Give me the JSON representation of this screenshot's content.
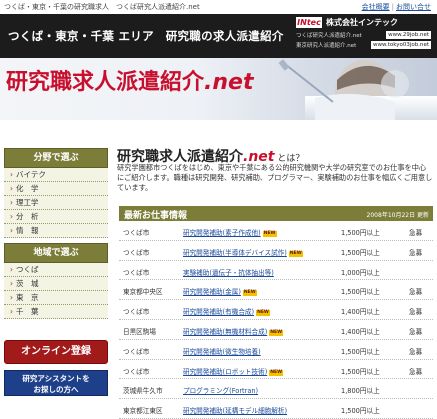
{
  "top": {
    "tagline": "つくば・東京・千葉の研究職求人　つくば研究人派遣紹介.net",
    "links": [
      "会社概要",
      "お問い合せ"
    ]
  },
  "header": {
    "title": "つくば・東京・千葉 エリア　研究職の求人派遣紹介",
    "company_logo": "INtec",
    "company_name": "株式会社インテック",
    "sites": [
      {
        "label": "つくば研究人派遣紹介.net",
        "url": "www.29job.net"
      },
      {
        "label": "東京研究人派遣紹介.net",
        "url": "www.tokyo03job.net"
      }
    ]
  },
  "hero": {
    "title_main": "研究職求人派遣紹介",
    "title_net": ".net"
  },
  "sidebar": {
    "field_heading": "分野で選ぶ",
    "field_items": [
      "バイテク",
      "化　学",
      "理工学",
      "分　析",
      "情　報"
    ],
    "region_heading": "地域で選ぶ",
    "region_items": [
      "つくば",
      "茨　城",
      "東　京",
      "千　葉"
    ],
    "register_label": "オンライン登録",
    "assistant_line1": "研究アシスタントを",
    "assistant_line2": "お探しの方へ"
  },
  "intro": {
    "title_main": "研究職求人派遣紹介",
    "title_net": ".net",
    "title_suffix": " とは？",
    "body": "研究学園都市つくばをはじめ、東京や千葉にある公的研究機関や大学の研究室でのお仕事を中心にご紹介します。職種は研究開発、研究補助、プログラマー、実験補助のお仕事を幅広くご用意しています。"
  },
  "jobs": {
    "heading": "最新お仕事情報",
    "updated": "2008年10月22日 更新",
    "badge": "NEW",
    "rows": [
      {
        "location": "つくば市",
        "title": "研究開発補助(素子作成他)",
        "new": true,
        "salary": "1,500円以上",
        "status": "急募"
      },
      {
        "location": "つくば市",
        "title": "研究開発補助(半導体デバイス試作)",
        "new": true,
        "salary": "1,500円以上",
        "status": "急募"
      },
      {
        "location": "つくば市",
        "title": "実験補助(遺伝子・抗体抽出等)",
        "new": false,
        "salary": "1,000円以上",
        "status": ""
      },
      {
        "location": "東京都中央区",
        "title": "研究開発補助(金属)",
        "new": true,
        "salary": "1,500円以上",
        "status": "急募"
      },
      {
        "location": "つくば市",
        "title": "研究開発補助(有機合成)",
        "new": true,
        "salary": "1,400円以上",
        "status": "急募"
      },
      {
        "location": "日黒区駒場",
        "title": "研究開発補助(無機材料合成)",
        "new": true,
        "salary": "1,400円以上",
        "status": "急募"
      },
      {
        "location": "つくば市",
        "title": "研究開発補助(微生物培養)",
        "new": false,
        "salary": "1,500円以上",
        "status": "急募"
      },
      {
        "location": "つくば市",
        "title": "研究開発補助(ロボット技術)",
        "new": true,
        "salary": "1,500円以上",
        "status": "急募"
      },
      {
        "location": "茨城県牛久市",
        "title": "プログラミング(Fortran)",
        "new": false,
        "salary": "1,800円以上",
        "status": ""
      },
      {
        "location": "東京都江東区",
        "title": "研究開発補助(延構モデル細胞解析)",
        "new": false,
        "salary": "1,500円以上",
        "status": ""
      }
    ]
  }
}
